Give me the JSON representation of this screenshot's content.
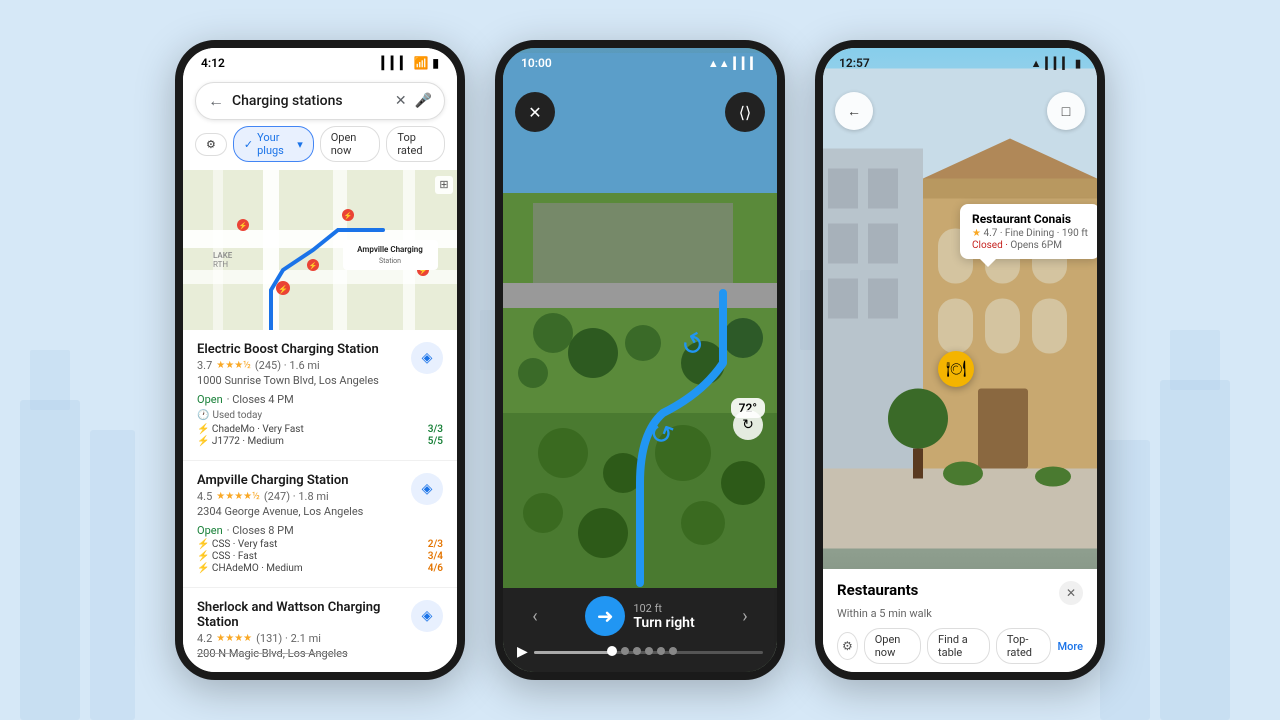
{
  "background": "#d6e8f7",
  "phone1": {
    "time": "4:12",
    "search_placeholder": "Charging stations",
    "filters": {
      "icon_label": "⚙",
      "your_plugs": "✓ Your plugs",
      "open_now": "Open now",
      "top_rated": "Top rated"
    },
    "stations": [
      {
        "name": "Electric Boost Charging Station",
        "rating": "3.7",
        "review_count": "(245)",
        "distance": "1.6 mi",
        "address": "1000 Sunrise Town Blvd, Los Angeles",
        "status": "Open",
        "closes": "Closes 4 PM",
        "used_today": "Used today",
        "chargers": [
          {
            "type": "ChadeMo",
            "speed": "Very Fast",
            "avail": "3/3",
            "color": "green"
          },
          {
            "type": "J1772",
            "speed": "Medium",
            "avail": "5/5",
            "color": "green"
          }
        ]
      },
      {
        "name": "Ampville Charging Station",
        "rating": "4.5",
        "review_count": "(247)",
        "distance": "1.8 mi",
        "address": "2304 George Avenue, Los Angeles",
        "status": "Open",
        "closes": "Closes 8 PM",
        "chargers": [
          {
            "type": "CSS",
            "speed": "Very fast",
            "avail": "2/3",
            "color": "orange"
          },
          {
            "type": "CSS",
            "speed": "Fast",
            "avail": "3/4",
            "color": "orange"
          },
          {
            "type": "CHAdeMO",
            "speed": "Medium",
            "avail": "4/6",
            "color": "orange"
          }
        ]
      },
      {
        "name": "Sherlock and Wattson Charging Station",
        "rating": "4.2",
        "review_count": "(131)",
        "distance": "2.1 mi",
        "address": "200 N Magic Blvd, Los Angeles"
      }
    ]
  },
  "phone2": {
    "time": "10:00",
    "temperature": "72°",
    "navigation": {
      "distance": "102 ft",
      "instruction": "Turn right"
    }
  },
  "phone3": {
    "time": "12:57",
    "place": {
      "name": "Restaurant Conais",
      "rating": "4.7",
      "category": "Fine Dining",
      "distance": "190 ft",
      "status": "Closed",
      "opens": "Opens 6PM"
    },
    "panel": {
      "title": "Restaurants",
      "subtitle": "Within a 5 min walk",
      "filters": [
        "Open now",
        "Find a table",
        "Top-rated",
        "More"
      ]
    }
  }
}
